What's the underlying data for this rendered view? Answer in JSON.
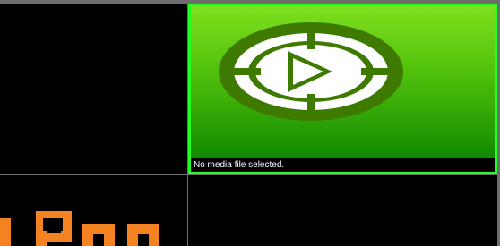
{
  "media_panel": {
    "status_text": "No media file selected.",
    "icon": "play-target-icon"
  },
  "brand_logo": {
    "partial_text": "nPanels",
    "icon": "logo-mark"
  },
  "colors": {
    "selection_border": "#22ff22",
    "thumb_top": "#7fe01d",
    "thumb_bottom": "#118a00",
    "icon_dark": "#3f7a00",
    "icon_light": "#ffffff",
    "logo_orange": "#f58220",
    "grid_lines": "#6e6e6e"
  }
}
